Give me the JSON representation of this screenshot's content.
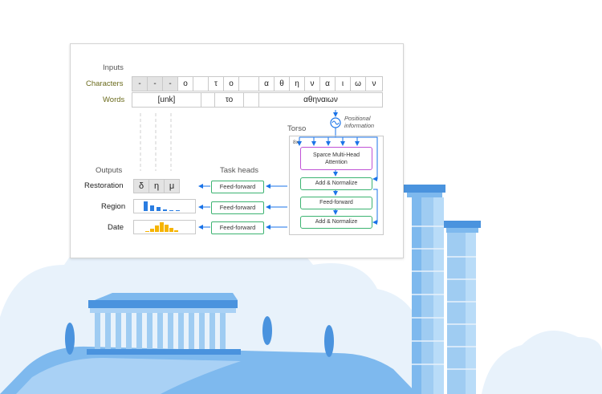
{
  "diagram": {
    "inputs_label": "Inputs",
    "characters_label": "Characters",
    "words_label": "Words",
    "characters": [
      "-",
      "-",
      "-",
      "o",
      "",
      "τ",
      "o",
      "",
      "α",
      "θ",
      "η",
      "ν",
      "α",
      "ι",
      "ω",
      "ν"
    ],
    "words": [
      "[unk]",
      "το",
      "αθηναιων"
    ],
    "positional_label_1": "Positional",
    "positional_label_2": "information",
    "torso_label": "Torso",
    "torso_repeat": "8x",
    "attention_label_1": "Sparce Multi-Head",
    "attention_label_2": "Attention",
    "add_normalize_1": "Add & Normalize",
    "feed_forward_torso": "Feed-forward",
    "add_normalize_2": "Add & Normalize",
    "outputs_label": "Outputs",
    "task_heads_label": "Task heads",
    "restoration_label": "Restoration",
    "region_label": "Region",
    "date_label": "Date",
    "restoration_chars": [
      "δ",
      "η",
      "μ"
    ],
    "feed_forward_head": "Feed-forward",
    "region_bars": [
      1.0,
      0.55,
      0.38,
      0.2,
      0.1,
      0.06
    ],
    "date_bars": [
      0.1,
      0.3,
      0.7,
      1.0,
      0.75,
      0.45,
      0.15
    ]
  },
  "colors": {
    "accent_blue": "#1a73e8",
    "green": "#3cb371",
    "purple": "#c052d6",
    "region_blue": "#2a7de1",
    "date_yellow": "#f6b400",
    "sky_light": "#e8f2fb",
    "building_blue": "#7eb9ee",
    "building_dark": "#4a93de"
  }
}
